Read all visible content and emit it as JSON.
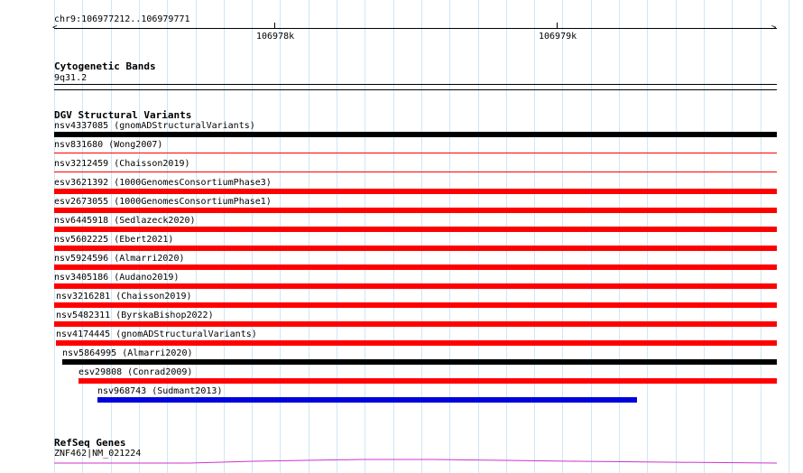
{
  "ruler": {
    "range_label": "chr9:106977212..106979771",
    "ticks": [
      "106978k",
      "106979k"
    ]
  },
  "tracks": {
    "cytoband": {
      "title": "Cytogenetic Bands",
      "band": "9q31.2"
    },
    "dgv": {
      "title": "DGV Structural Variants",
      "features": [
        {
          "label": "nsv4337085 (gnomADStructuralVariants)",
          "color": "#000000"
        },
        {
          "label": "nsv831680 (Wong2007)",
          "color": "#ff0000"
        },
        {
          "label": "nsv3212459 (Chaisson2019)",
          "color": "#ff0000"
        },
        {
          "label": "esv3621392 (1000GenomesConsortiumPhase3)",
          "color": "#ff0000"
        },
        {
          "label": "esv2673055 (1000GenomesConsortiumPhase1)",
          "color": "#ff0000"
        },
        {
          "label": "nsv6445918 (Sedlazeck2020)",
          "color": "#ff0000"
        },
        {
          "label": "nsv5602225 (Ebert2021)",
          "color": "#ff0000"
        },
        {
          "label": "nsv5924596 (Almarri2020)",
          "color": "#ff0000"
        },
        {
          "label": "nsv3405186 (Audano2019)",
          "color": "#ff0000"
        },
        {
          "label": "nsv3216281 (Chaisson2019)",
          "color": "#ff0000"
        },
        {
          "label": "nsv5482311 (ByrskaBishop2022)",
          "color": "#ff0000"
        },
        {
          "label": "nsv4174445 (gnomADStructuralVariants)",
          "color": "#ff0000"
        },
        {
          "label": "nsv5864995 (Almarri2020)",
          "color": "#000000"
        },
        {
          "label": "esv29808 (Conrad2009)",
          "color": "#ff0000"
        },
        {
          "label": "nsv968743 (Sudmant2013)",
          "color": "#0000dd"
        }
      ]
    },
    "refseq": {
      "title": "RefSeq Genes",
      "gene": "ZNF462|NM_021224",
      "color": "#cc33cc"
    }
  }
}
